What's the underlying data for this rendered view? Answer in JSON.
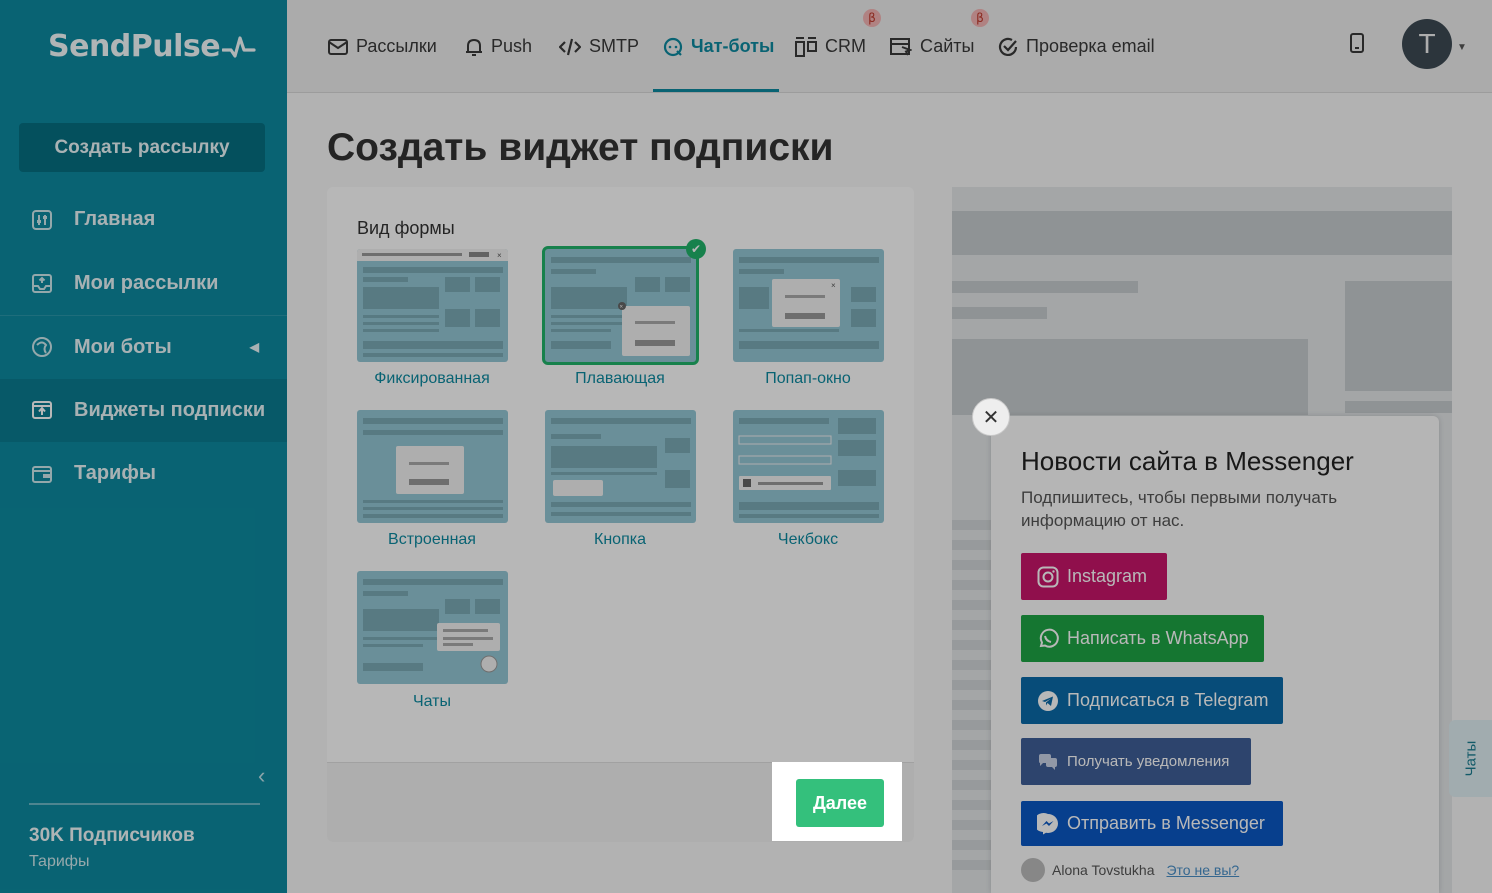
{
  "app": {
    "logo": "SendPulse"
  },
  "sidebar": {
    "create_button": "Создать рассылку",
    "items": [
      {
        "label": "Главная",
        "icon": "sliders-icon"
      },
      {
        "label": "Мои рассылки",
        "icon": "inbox-icon"
      },
      {
        "label": "Мои боты",
        "icon": "bots-icon"
      },
      {
        "label": "Виджеты подписки",
        "icon": "widget-icon"
      },
      {
        "label": "Тарифы",
        "icon": "wallet-icon"
      }
    ],
    "subscribers": "30K Подписчиков",
    "tariffs_link": "Тарифы"
  },
  "topnav": {
    "items": [
      {
        "label": "Рассылки",
        "icon": "mail-icon"
      },
      {
        "label": "Push",
        "icon": "bell-icon"
      },
      {
        "label": "SMTP",
        "icon": "code-icon"
      },
      {
        "label": "Чат-боты",
        "icon": "chat-icon"
      },
      {
        "label": "CRM",
        "icon": "crm-icon"
      },
      {
        "label": "Сайты",
        "icon": "site-icon"
      },
      {
        "label": "Проверка email",
        "icon": "check-icon"
      }
    ],
    "beta_label": "β",
    "avatar_letter": "T"
  },
  "page": {
    "title": "Создать виджет подписки",
    "form_label": "Вид формы",
    "tiles": [
      {
        "label": "Фиксированная"
      },
      {
        "label": "Плавающая"
      },
      {
        "label": "Попап-окно"
      },
      {
        "label": "Встроенная"
      },
      {
        "label": "Кнопка"
      },
      {
        "label": "Чекбокс"
      },
      {
        "label": "Чаты"
      }
    ],
    "next_button": "Далее"
  },
  "widget": {
    "title": "Новости сайта в Messenger",
    "description": "Подпишитесь, чтобы первыми получать информацию от нас.",
    "buttons": [
      {
        "label": "Instagram",
        "color": "#c8156a"
      },
      {
        "label": "Написать в WhatsApp",
        "color": "#1ea444"
      },
      {
        "label": "Подписаться в Telegram",
        "color": "#0b6aa8"
      },
      {
        "label": "Получать уведомления",
        "color": "#3f5f98"
      },
      {
        "label": "Отправить в Messenger",
        "color": "#0a58c4"
      }
    ],
    "user_name": "Alona Tovstukha",
    "not_you": "Это не вы?",
    "chats_tab": "Чаты"
  }
}
